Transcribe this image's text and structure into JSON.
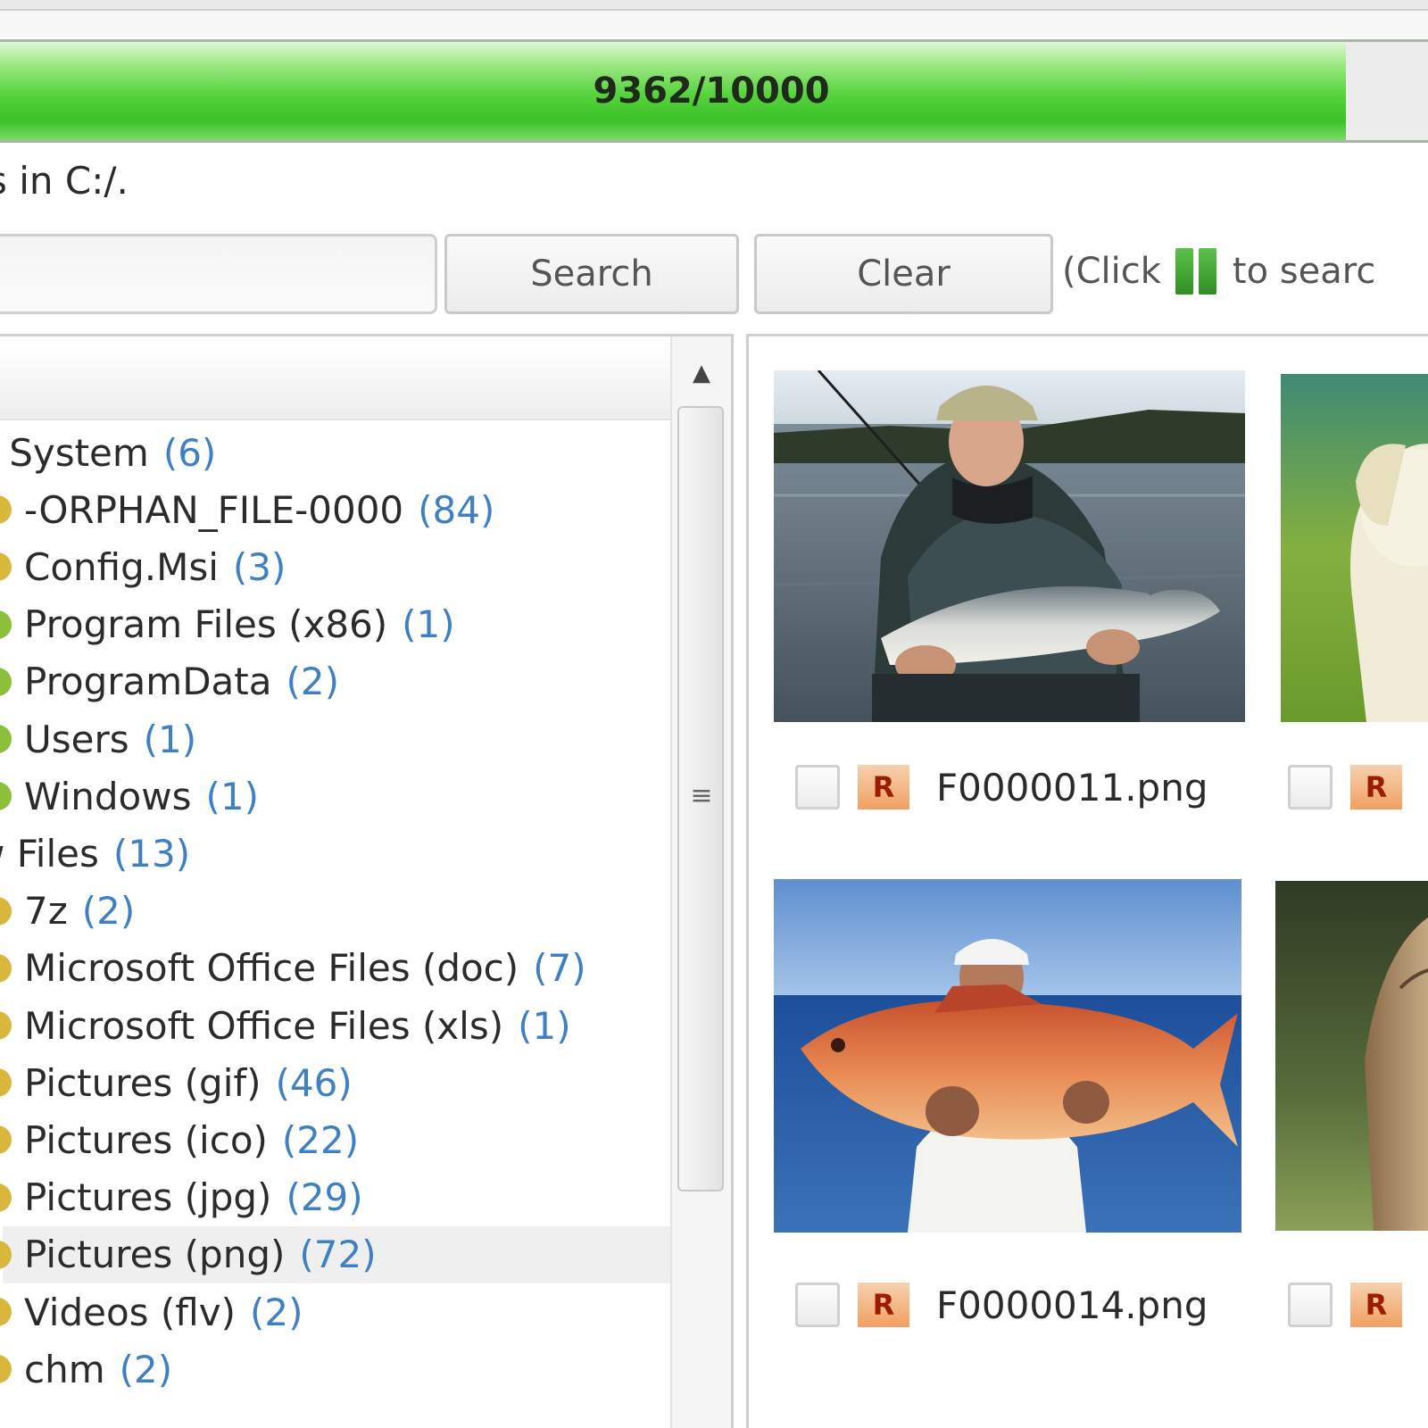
{
  "progress": {
    "text": "9362/10000",
    "value": 9362,
    "total": 10000,
    "fill_fraction": 0.936
  },
  "scan_status": "s in C:/.",
  "search": {
    "placeholder": "",
    "value": "",
    "search_label": "Search",
    "clear_label": "Clear"
  },
  "hint": {
    "prefix": "(Click",
    "suffix": "to searc",
    "icon": "play-pause-icon"
  },
  "tree": {
    "items": [
      {
        "label": "e System",
        "count": "(6)",
        "level": "top"
      },
      {
        "label": "-ORPHAN_FILE-0000",
        "count": "(84)",
        "level": "child",
        "icon": "folder-icon"
      },
      {
        "label": "Config.Msi",
        "count": "(3)",
        "level": "child",
        "icon": "folder-icon"
      },
      {
        "label": "Program Files (x86)",
        "count": "(1)",
        "level": "child",
        "icon": "folder-icon"
      },
      {
        "label": "ProgramData",
        "count": "(2)",
        "level": "child",
        "icon": "folder-icon"
      },
      {
        "label": "Users",
        "count": "(1)",
        "level": "child",
        "icon": "folder-icon"
      },
      {
        "label": "Windows",
        "count": "(1)",
        "level": "child",
        "icon": "folder-icon"
      },
      {
        "label": "w Files",
        "count": "(13)",
        "level": "top"
      },
      {
        "label": "7z",
        "count": "(2)",
        "level": "child",
        "icon": "folder-icon"
      },
      {
        "label": "Microsoft Office Files (doc)",
        "count": "(7)",
        "level": "child",
        "icon": "folder-icon"
      },
      {
        "label": "Microsoft Office Files (xls)",
        "count": "(1)",
        "level": "child",
        "icon": "folder-icon"
      },
      {
        "label": "Pictures (gif)",
        "count": "(46)",
        "level": "child",
        "icon": "folder-icon"
      },
      {
        "label": "Pictures (ico)",
        "count": "(22)",
        "level": "child",
        "icon": "folder-icon"
      },
      {
        "label": "Pictures (jpg)",
        "count": "(29)",
        "level": "child",
        "icon": "folder-icon"
      },
      {
        "label": "Pictures (png)",
        "count": "(72)",
        "level": "child",
        "icon": "folder-icon",
        "selected": true
      },
      {
        "label": "Videos (flv)",
        "count": "(2)",
        "level": "child",
        "icon": "folder-icon"
      },
      {
        "label": "chm",
        "count": "(2)",
        "level": "child",
        "icon": "folder-icon"
      }
    ]
  },
  "files": [
    {
      "name": "F0000011.png",
      "image": "man holding fish on lake photo",
      "icon": "image-file-icon",
      "icon_text": "R"
    },
    {
      "name": "",
      "image": "dog on grass photo",
      "icon": "image-file-icon",
      "icon_text": "R"
    },
    {
      "name": "F0000014.png",
      "image": "man holding red fish at sea photo",
      "icon": "image-file-icon",
      "icon_text": "R"
    },
    {
      "name": "",
      "image": "animal photo",
      "icon": "image-file-icon",
      "icon_text": "R"
    }
  ],
  "colors": {
    "progress_green": "#3cc128",
    "count_blue": "#3f7fc4",
    "border_gray": "#cfcfcf"
  }
}
